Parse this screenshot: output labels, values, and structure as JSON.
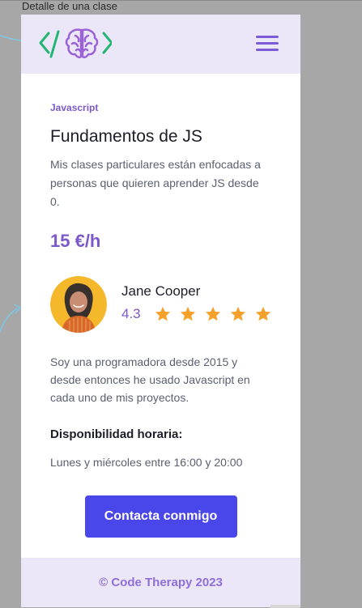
{
  "canvas": {
    "frame_label": "Detalle de una clase"
  },
  "header": {
    "logo_icon": "brain-code-logo-icon",
    "menu_icon": "hamburger-menu-icon"
  },
  "main": {
    "category": "Javascript",
    "title": "Fundamentos de JS",
    "description": "Mis clases particulares están enfocadas a personas que quieren aprender JS desde 0.",
    "price": "15 €/h",
    "teacher": {
      "name": "Jane Cooper",
      "rating": "4.3",
      "stars": 5,
      "avatar_icon": "teacher-avatar-icon"
    },
    "bio": "Soy una programadora desde 2015 y desde entonces he usado Javascript en cada uno de mis proyectos.",
    "availability_title": "Disponibilidad horaria:",
    "availability_text": "Lunes y miércoles entre 16:00 y 20:00",
    "cta_label": "Contacta conmigo"
  },
  "footer": {
    "text": "© Code Therapy 2023"
  },
  "colors": {
    "canvas_background": "#a7a7a7",
    "accent_purple": "#7b59c9",
    "header_background": "#ece7f8",
    "button_blue": "#4a47ea",
    "star_orange": "#f5a12b",
    "logo_green": "#22b573"
  }
}
